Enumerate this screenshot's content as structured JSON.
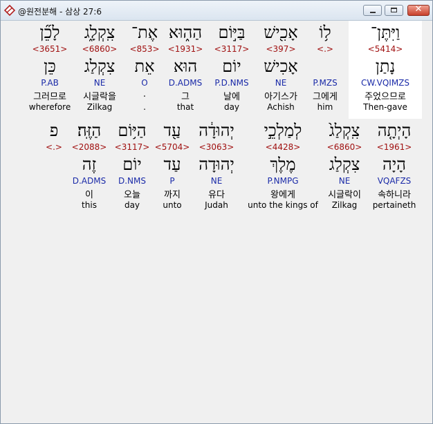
{
  "window": {
    "title": "@원전분해 - 삼상 27:6",
    "icon": "app-diamond-icon",
    "close_glyph": "✕"
  },
  "verse": {
    "row1": [
      {
        "heb": "וַיִּתֶּן־",
        "strong": "<5414>",
        "lex": "נָתַן",
        "morph": "CW.VQIMZS",
        "kor": "주었으므로",
        "eng": "Then-gave",
        "highlight": true
      },
      {
        "heb": "ל֥וֹ",
        "strong": "<.>",
        "lex": "",
        "morph": "P.MZS",
        "kor": "그에게",
        "eng": "him"
      },
      {
        "heb": "אָכִ֖ישׁ",
        "strong": "<397>",
        "lex": "אָכִישׁ",
        "morph": "NE",
        "kor": "아기스가",
        "eng": "Achish"
      },
      {
        "heb": "בַּיּ֣וֹם",
        "strong": "<3117>",
        "lex": "יוֹם",
        "morph": "P.D.NMS",
        "kor": "날에",
        "eng": "day"
      },
      {
        "heb": "הַה֑וּא",
        "strong": "<1931>",
        "lex": "הוּא",
        "morph": "D.ADMS",
        "kor": "그",
        "eng": "that"
      },
      {
        "heb": "אֶת־",
        "strong": "<853>",
        "lex": "אֵת",
        "morph": "O",
        "kor": ".",
        "eng": "."
      },
      {
        "heb": "צִֽקְלָ֑ג",
        "strong": "<6860>",
        "lex": "צִקְלַג",
        "morph": "NE",
        "kor": "시글락을",
        "eng": "Zilkag"
      },
      {
        "heb": "לָכֵ֞ן",
        "strong": "<3651>",
        "lex": "כֵּן",
        "morph": "P.AB",
        "kor": "그러므로",
        "eng": "wherefore"
      }
    ],
    "row2": [
      {
        "heb": "הָיְתָ֤ה",
        "strong": "<1961>",
        "lex": "הָיָה",
        "morph": "VQAFZS",
        "kor": "속하니라",
        "eng": "pertaineth"
      },
      {
        "heb": "צִֽקְלַג֙",
        "strong": "<6860>",
        "lex": "צִקְלַג",
        "morph": "NE",
        "kor": "시글락이",
        "eng": "Zilkag"
      },
      {
        "heb": "לְמַלְכֵ֣י",
        "strong": "<4428>",
        "lex": "מֶלֶךְ",
        "morph": "P.NMPG",
        "kor": "왕에게",
        "eng": "unto the kings of"
      },
      {
        "heb": "יְהוּדָ֔ה",
        "strong": "<3063>",
        "lex": "יְהוּדָה",
        "morph": "NE",
        "kor": "유다",
        "eng": "Judah"
      },
      {
        "heb": "עַ֖ד",
        "strong": "<5704>",
        "lex": "עַד",
        "morph": "P",
        "kor": "까지",
        "eng": "unto"
      },
      {
        "heb": "הַיּ֥וֹם",
        "strong": "<3117>",
        "lex": "יוֹם",
        "morph": "D.NMS",
        "kor": "오늘",
        "eng": "day"
      },
      {
        "heb": "הַזֶּֽה׃",
        "strong": "<2088>",
        "lex": "זֶה",
        "morph": "D.ADMS",
        "kor": "이",
        "eng": "this"
      },
      {
        "heb": "פ",
        "strong": "<.>",
        "lex": "",
        "morph": "",
        "kor": "",
        "eng": ""
      }
    ]
  }
}
